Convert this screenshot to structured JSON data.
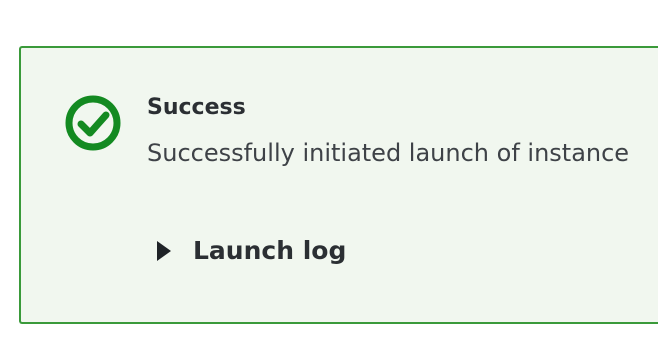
{
  "alert": {
    "status": "success",
    "icon": "check-circle-icon",
    "title": "Success",
    "message": "Successfully initiated launch of instance",
    "expander_label": "Launch log",
    "colors": {
      "accent": "#3a9a3a",
      "background": "#f1f7ef",
      "text": "#2b2f33"
    }
  }
}
